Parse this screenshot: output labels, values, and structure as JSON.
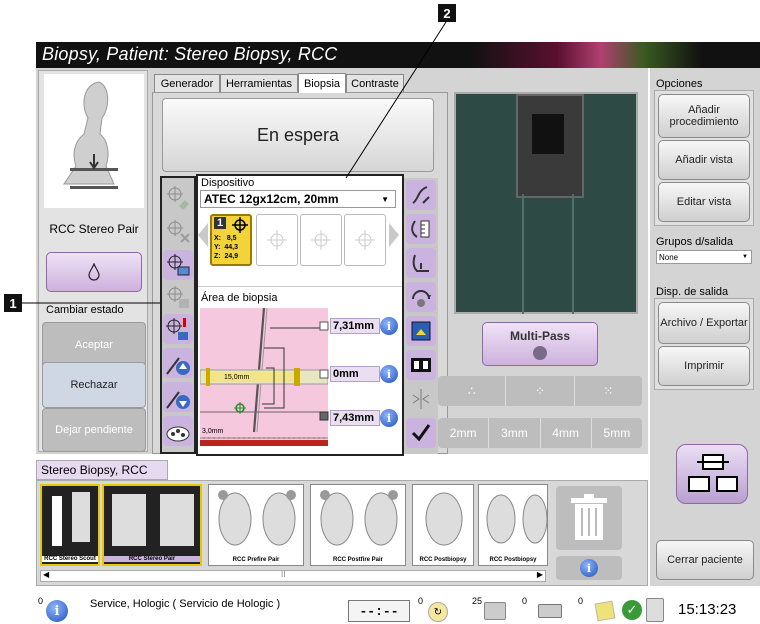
{
  "callouts": {
    "one": "1",
    "two": "2"
  },
  "title": "Biopsy, Patient:  Stereo Biopsy, RCC",
  "tabs": [
    "Generador",
    "Herramientas",
    "Biopsia",
    "Contraste"
  ],
  "left": {
    "view_label": "RCC Stereo Pair",
    "change_state": "Cambiar estado",
    "accept": "Aceptar",
    "reject": "Rechazar",
    "pending": "Dejar pendiente"
  },
  "status_banner": "En espera",
  "device": {
    "label": "Dispositivo",
    "selected": "ATEC 12gx12cm, 20mm",
    "target_number": "1",
    "coords": [
      "X:   8,5",
      "Y:  44,3",
      "Z:  24,9"
    ]
  },
  "biopsy_area": {
    "label": "Área de biopsia",
    "stroke_label": "15,0mm",
    "bottom_label": "3,0mm",
    "measurements": [
      "7,31mm",
      "0mm",
      "7,43mm"
    ]
  },
  "multipass": {
    "label": "Multi-Pass",
    "offsets": [
      "2mm",
      "3mm",
      "4mm",
      "5mm"
    ]
  },
  "options": {
    "header": "Opciones",
    "add_procedure": "Añadir procedimiento",
    "add_view": "Añadir vista",
    "edit_view": "Editar vista",
    "output_groups_label": "Grupos d/salida",
    "output_groups_value": "None",
    "output_devices_label": "Disp. de salida",
    "archive_export": "Archivo / Exportar",
    "print": "Imprimir",
    "close_patient": "Cerrar paciente"
  },
  "thumbnail_tab": "Stereo Biopsy, RCC",
  "thumbnails": [
    "RCC Stereo Scout",
    "RCC Stereo Pair",
    "RCC Prefire Pair",
    "RCC Postfire Pair",
    "RCC Postbiopsy",
    "RCC Postbiopsy"
  ],
  "scroll_mark": "II",
  "status_bar": {
    "alerts_count": "0",
    "service_text": "Service, Hologic ( Servicio de Hologic )",
    "timer": "--:--",
    "count_a": "0",
    "count_b": "25",
    "count_c": "0",
    "count_d": "0",
    "clock": "15:13:23"
  },
  "colors": {
    "accent_purple": "#cdb1dd",
    "pink_area": "#f6c8dd",
    "target_yellow": "#f2d43a",
    "dark_teal": "#2d4a44"
  }
}
